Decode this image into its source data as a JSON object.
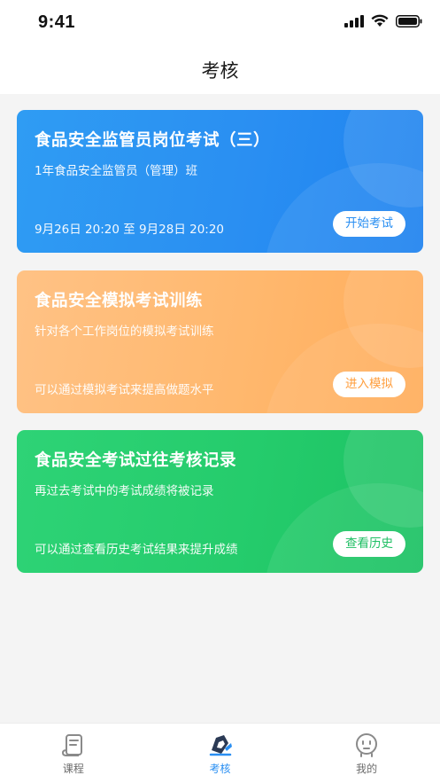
{
  "status_bar": {
    "time": "9:41"
  },
  "header": {
    "title": "考核"
  },
  "cards": [
    {
      "title": "食品安全监管员岗位考试（三）",
      "subtitle": "1年食品安全监管员（管理）班",
      "footer": "9月26日 20:20 至 9月28日 20:20",
      "button": "开始考试",
      "accent": "#2a8ff2"
    },
    {
      "title": "食品安全模拟考试训练",
      "subtitle": "针对各个工作岗位的模拟考试训练",
      "footer": "可以通过模拟考试来提高做题水平",
      "button": "进入模拟",
      "accent": "#ff9e3d"
    },
    {
      "title": "食品安全考试过往考核记录",
      "subtitle": "再过去考试中的考试成绩将被记录",
      "footer": "可以通过查看历史考试结果来提升成绩",
      "button": "查看历史",
      "accent": "#1fbf64"
    }
  ],
  "tabbar": {
    "active_color": "#2a8ff2",
    "items": [
      {
        "label": "课程",
        "icon": "course-icon"
      },
      {
        "label": "考核",
        "icon": "exam-icon"
      },
      {
        "label": "我的",
        "icon": "profile-icon"
      }
    ]
  }
}
